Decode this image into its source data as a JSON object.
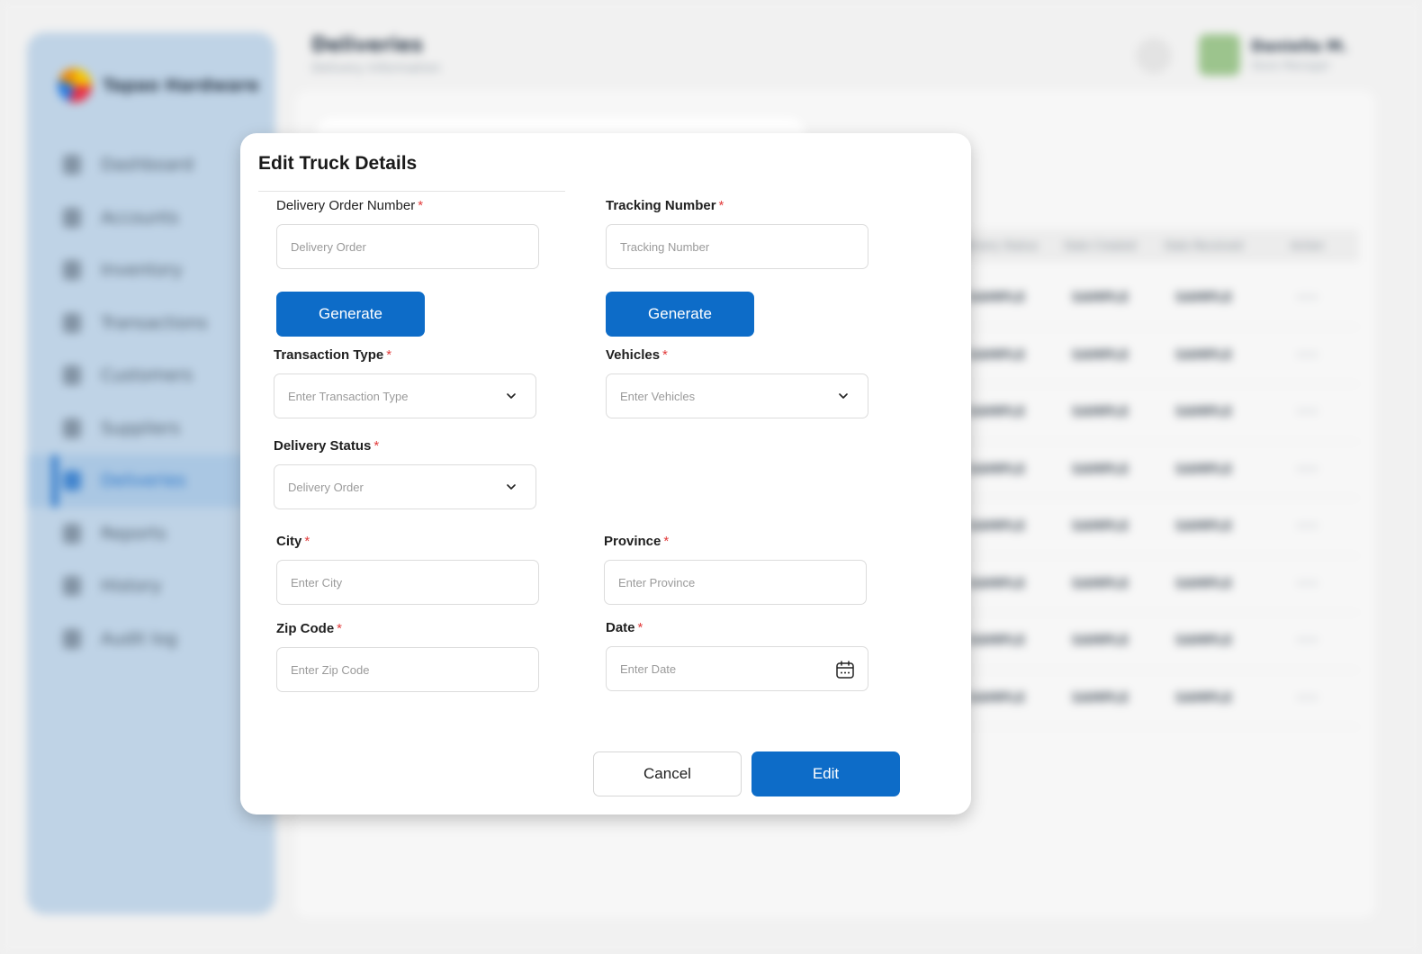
{
  "background": {
    "logo_text": "Tapao Hardware",
    "nav_items": [
      "Dashboard",
      "Accounts",
      "Inventory",
      "Transactions",
      "Customers",
      "Suppliers",
      "Deliveries",
      "Reports",
      "History",
      "Audit log"
    ],
    "active_nav": "Deliveries",
    "page_title": "Deliveries",
    "page_subtitle": "Delivery Information",
    "user_name": "Daniella M.",
    "user_role": "Store Manager",
    "table_headers": [
      "Delivery Status",
      "Date Created",
      "Date Received",
      "Action"
    ],
    "table_rows": [
      [
        "SAMPLE",
        "SAMPLE",
        "SAMPLE",
        "•••"
      ],
      [
        "SAMPLE",
        "SAMPLE",
        "SAMPLE",
        "•••"
      ],
      [
        "SAMPLE",
        "SAMPLE",
        "SAMPLE",
        "•••"
      ],
      [
        "SAMPLE",
        "SAMPLE",
        "SAMPLE",
        "•••"
      ],
      [
        "SAMPLE",
        "SAMPLE",
        "SAMPLE",
        "•••"
      ],
      [
        "SAMPLE",
        "SAMPLE",
        "SAMPLE",
        "•••"
      ],
      [
        "SAMPLE",
        "SAMPLE",
        "SAMPLE",
        "•••"
      ],
      [
        "SAMPLE",
        "SAMPLE",
        "SAMPLE",
        "•••"
      ]
    ]
  },
  "modal": {
    "title": "Edit Truck Details",
    "required_mark": "*",
    "delivery_order_number": {
      "label": "Delivery Order Number",
      "placeholder": "Delivery Order",
      "value": ""
    },
    "tracking_number": {
      "label": "Tracking Number",
      "placeholder": "Tracking Number",
      "value": ""
    },
    "generate_label": "Generate",
    "transaction_type": {
      "label": "Transaction Type",
      "placeholder": "Enter Transaction Type"
    },
    "vehicles": {
      "label": "Vehicles",
      "placeholder": "Enter Vehicles"
    },
    "delivery_status": {
      "label": "Delivery Status",
      "placeholder": "Delivery Order"
    },
    "city": {
      "label": "City",
      "placeholder": "Enter City"
    },
    "province": {
      "label": "Province",
      "placeholder": "Enter Province"
    },
    "zip_code": {
      "label": "Zip Code",
      "placeholder": "Enter Zip Code"
    },
    "date": {
      "label": "Date",
      "placeholder": "Enter Date"
    },
    "cancel_label": "Cancel",
    "edit_label": "Edit"
  },
  "colors": {
    "primary": "#0d6cc8",
    "required": "#e23b3b",
    "sidebar": "#bfd3e6"
  },
  "icons": {
    "dropdown": "chevron-down-icon",
    "date": "calendar-icon"
  }
}
